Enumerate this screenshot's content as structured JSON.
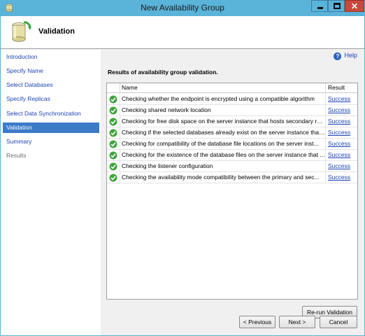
{
  "window": {
    "title": "New Availability Group"
  },
  "header": {
    "title": "Validation"
  },
  "sidebar": {
    "items": [
      {
        "label": "Introduction",
        "state": "link"
      },
      {
        "label": "Specify Name",
        "state": "link"
      },
      {
        "label": "Select Databases",
        "state": "link"
      },
      {
        "label": "Specify Replicas",
        "state": "link"
      },
      {
        "label": "Select Data Synchronization",
        "state": "link"
      },
      {
        "label": "Validation",
        "state": "active"
      },
      {
        "label": "Summary",
        "state": "link"
      },
      {
        "label": "Results",
        "state": "disabled"
      }
    ]
  },
  "help": {
    "label": "Help"
  },
  "main": {
    "heading": "Results of availability group validation.",
    "columns": {
      "name": "Name",
      "result": "Result"
    },
    "rows": [
      {
        "name": "Checking whether the endpoint is encrypted using a compatible algorithm",
        "result": "Success"
      },
      {
        "name": "Checking shared network location",
        "result": "Success"
      },
      {
        "name": "Checking for free disk space on the server instance that hosts secondary re...",
        "result": "Success"
      },
      {
        "name": "Checking if the selected databases already exist on the server instance that ...",
        "result": "Success"
      },
      {
        "name": "Checking for compatibility of the database file locations on the server inst...",
        "result": "Success"
      },
      {
        "name": "Checking for the existence of the database files on the server instance that ...",
        "result": "Success"
      },
      {
        "name": "Checking the listener configuration",
        "result": "Success"
      },
      {
        "name": "Checking the availability mode compatibility between the primary and sec...",
        "result": "Success"
      }
    ]
  },
  "buttons": {
    "rerun": "Re-run Validation",
    "previous": "< Previous",
    "next": "Next >",
    "cancel": "Cancel"
  },
  "colors": {
    "titlebar": "#5ab3d9",
    "close_button": "#c9483c",
    "link": "#1c44b5",
    "nav_active": "#3d7bc9",
    "success_icon": "#3ea63a"
  },
  "icons": {
    "app": "database-cylinder-icon",
    "header": "database-refresh-icon",
    "status": "check-circle-icon",
    "help": "question-circle-icon"
  }
}
